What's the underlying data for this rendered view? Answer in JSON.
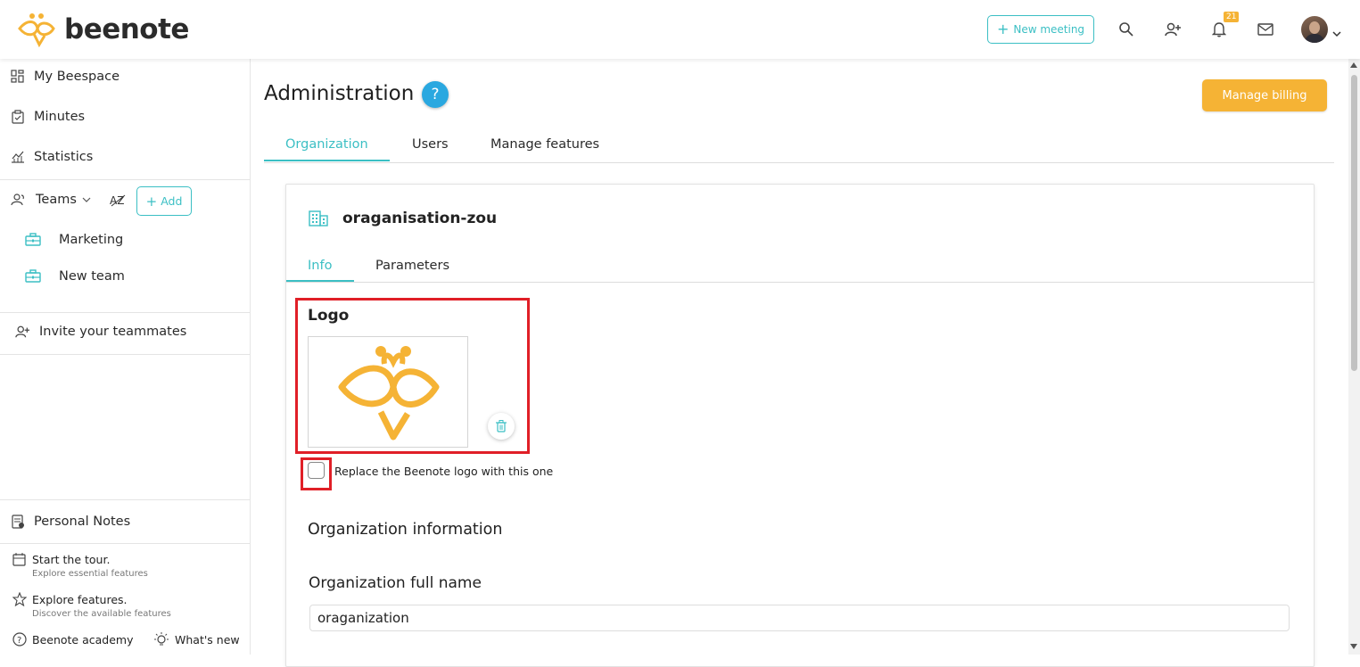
{
  "brand": {
    "name": "beenote",
    "accent": "#3bbfc4",
    "warning": "#f5b335",
    "highlight": "#e01f27"
  },
  "topbar": {
    "new_meeting_label": "New meeting",
    "notification_count": "21",
    "icons": [
      "search-icon",
      "add-user-icon",
      "bell-icon",
      "mail-icon",
      "avatar",
      "chevron-down-icon"
    ]
  },
  "sidebar": {
    "items": [
      {
        "label": "My Beespace",
        "icon": "grid-icon"
      },
      {
        "label": "Minutes",
        "icon": "clipboard-check-icon"
      },
      {
        "label": "Statistics",
        "icon": "chart-icon"
      }
    ],
    "teams": {
      "label": "Teams",
      "add_label": "Add",
      "list": [
        {
          "label": "Marketing",
          "icon": "briefcase-icon"
        },
        {
          "label": "New team",
          "icon": "briefcase-icon"
        }
      ]
    },
    "invite_label": "Invite your teammates",
    "personal_notes_label": "Personal Notes",
    "tour": {
      "title": "Start the tour.",
      "subtitle": "Explore essential features"
    },
    "explore": {
      "title": "Explore features.",
      "subtitle": "Discover the available features"
    },
    "academy_label": "Beenote academy",
    "whats_new_label": "What's new"
  },
  "main": {
    "title": "Administration",
    "help_label": "?",
    "billing_label": "Manage billing",
    "tabs": [
      {
        "label": "Organization",
        "active": true
      },
      {
        "label": "Users",
        "active": false
      },
      {
        "label": "Manage features",
        "active": false
      }
    ],
    "org": {
      "name": "oraganisation-zou",
      "subtabs": [
        {
          "label": "Info",
          "active": true
        },
        {
          "label": "Parameters",
          "active": false
        }
      ],
      "logo_label": "Logo",
      "replace_logo_label": "Replace the Beenote logo with this one",
      "replace_logo_checked": false,
      "section_title": "Organization information",
      "full_name_label": "Organization full name",
      "full_name_value": "oraganization"
    }
  }
}
